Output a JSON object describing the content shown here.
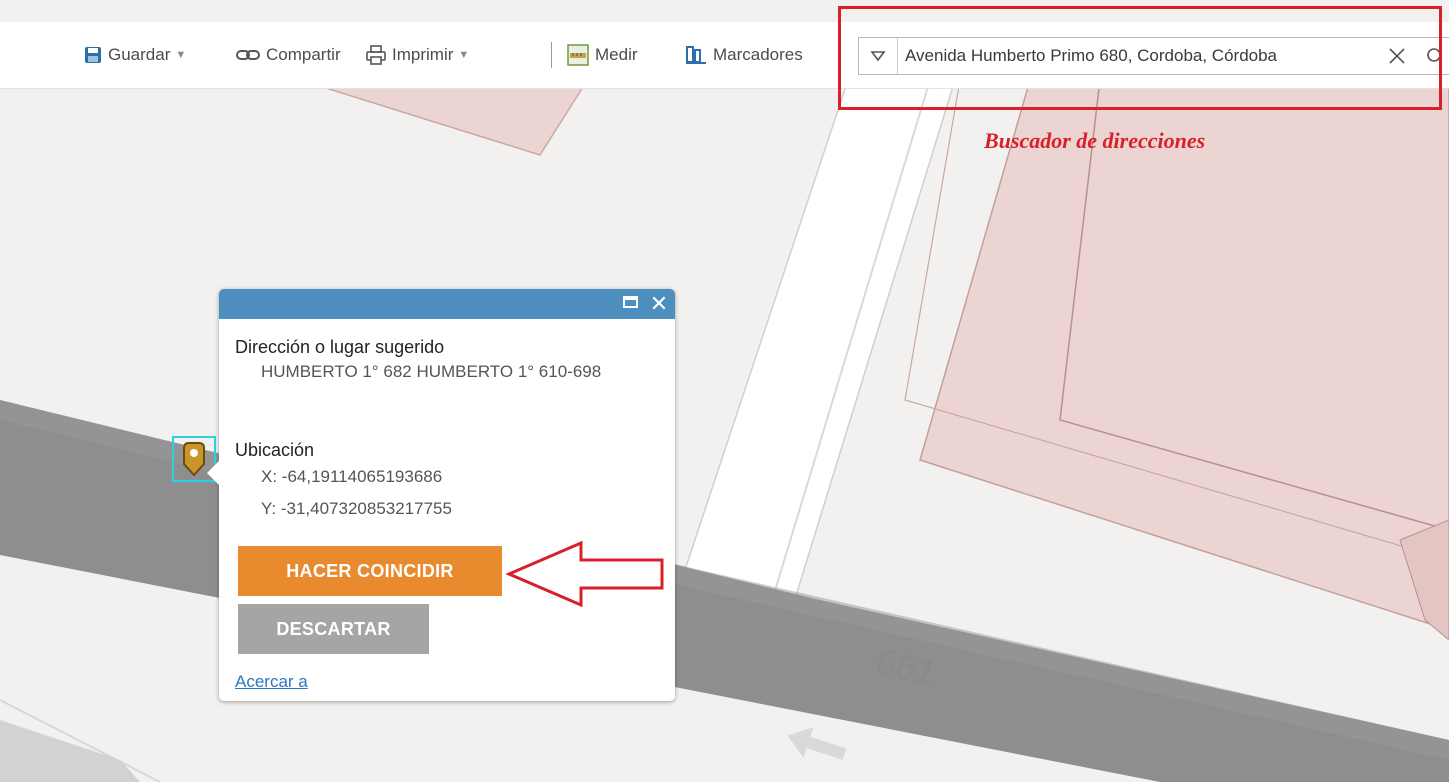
{
  "toolbar": {
    "save_label": "Guardar",
    "share_label": "Compartir",
    "print_label": "Imprimir",
    "measure_label": "Medir",
    "bookmarks_label": "Marcadores"
  },
  "search": {
    "value": "Avenida Humberto Primo 680, Cordoba, Córdoba"
  },
  "annotation": {
    "search_label": "Buscador de direcciones",
    "color": "#d8202a"
  },
  "map": {
    "parcel_number": "661",
    "parcel_color": "#ecd4d2",
    "road_color": "#8e8e8e"
  },
  "popup": {
    "header_color": "#4d8fbf",
    "close_symbol": "✕",
    "address_title": "Dirección o lugar sugerido",
    "address_value": "HUMBERTO 1° 682 HUMBERTO 1° 610-698",
    "location_title": "Ubicación",
    "x_value": "X: -64,19114065193686",
    "y_value": "Y: -31,407320853217755",
    "match_button": "HACER COINCIDIR",
    "discard_button": "DESCARTAR",
    "zoom_link": "Acercar a"
  },
  "icons": [
    "save-icon",
    "share-icon",
    "print-icon",
    "measure-icon",
    "bookmarks-icon",
    "dropdown-icon",
    "clear-icon",
    "search-icon",
    "pin-marker-icon",
    "maximize-icon",
    "close-icon"
  ]
}
